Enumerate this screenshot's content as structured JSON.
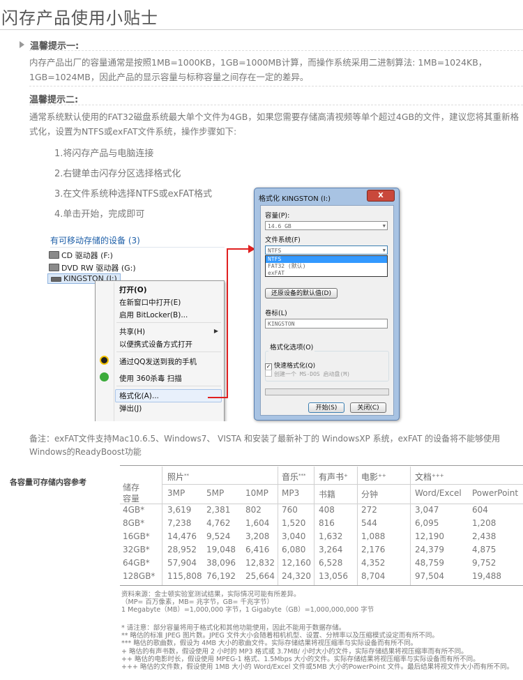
{
  "title": "闪存产品使用小贴士",
  "tip1": {
    "heading": "温馨提示一:",
    "text": "内存产品出厂的容量通常是按照1MB=1000KB，1GB=1000MB计算，而操作系统采用二进制算法: 1MB=1024KB，1GB=1024MB，因此产品的显示容量与标称容量之间存在一定的差异。"
  },
  "tip2": {
    "heading": "温馨提示二:",
    "text": "通常系统默认使用的FAT32磁盘系统最大单个文件为4GB，如果您需要存储高清视频等单个超过4GB的文件，建议您将其重新格式化，设置为NTFS或exFAT文件系统，操作步骤如下:"
  },
  "steps": [
    "1.将闪存产品与电脑连接",
    "2.右键单击闪存分区选择格式化",
    "3.在文件系统种选择NTFS或exFAT格式",
    "4.单击开始，完成即可"
  ],
  "explorer": {
    "header": "有可移动存储的设备 (3)",
    "drives": [
      "CD 驱动器 (F:)",
      "DVD RW 驱动器 (G:)",
      "KINGSTON (I:)"
    ],
    "menu": [
      "打开(O)",
      "在新窗口中打开(E)",
      "启用 BitLocker(B)...",
      "共享(H)",
      "以便携式设备方式打开",
      "通过QQ发送到我的手机",
      "使用 360杀毒 扫描",
      "格式化(A)...",
      "弹出(J)"
    ]
  },
  "dialog": {
    "title": "格式化 KINGSTON (I:)",
    "close": "X",
    "capacity_label": "容量(P):",
    "capacity_value": "14.6 GB",
    "fs_label": "文件系统(F)",
    "fs_value": "NTFS",
    "fs_options": [
      "NTFS",
      "FAT32 (默认)",
      "exFAT"
    ],
    "restore_button": "还原设备的默认值(D)",
    "volume_label": "卷标(L)",
    "volume_value": "KINGSTON",
    "options_label": "格式化选项(O)",
    "quick_format": "快速格式化(Q)",
    "msdos_disk": "创建一个 MS-DOS 启动盘(M)",
    "start_button": "开始(S)",
    "close_button": "关闭(C)"
  },
  "note": "备注：exFAT文件支持Mac10.6.5、Windows7、 VISTA 和安装了最新补丁的 WindowsXP 系统，exFAT 的设备将不能够使用Windows的ReadyBoost功能",
  "table": {
    "side_title": "各容量可存储内容参考",
    "groups": [
      {
        "label": "照片",
        "sup": "**"
      },
      {
        "label": "音乐",
        "sup": "***"
      },
      {
        "label": "有声书",
        "sup": "+"
      },
      {
        "label": "电影",
        "sup": "++"
      },
      {
        "label": "文档",
        "sup": "+++"
      }
    ],
    "capacity_header": [
      "储存",
      "容量"
    ],
    "subheaders": [
      "3MP",
      "5MP",
      "10MP",
      "MP3",
      "书籍",
      "分钟",
      "Word/Excel",
      "PowerPoint"
    ],
    "rows": [
      [
        "4GB*",
        "3,619",
        "2,381",
        "802",
        "760",
        "408",
        "272",
        "3,047",
        "604"
      ],
      [
        "8GB*",
        "7,238",
        "4,762",
        "1,604",
        "1,520",
        "816",
        "544",
        "6,095",
        "1,208"
      ],
      [
        "16GB*",
        "14,476",
        "9,524",
        "3,208",
        "3,040",
        "1,632",
        "1,088",
        "12,190",
        "2,438"
      ],
      [
        "32GB*",
        "28,952",
        "19,048",
        "6,416",
        "6,080",
        "3,264",
        "2,176",
        "24,379",
        "4,875"
      ],
      [
        "64GB*",
        "57,904",
        "38,096",
        "12,832",
        "12,160",
        "6,528",
        "4,352",
        "48,759",
        "9,752"
      ],
      [
        "128GB*",
        "115,808",
        "76,192",
        "25,664",
        "24,320",
        "13,056",
        "8,704",
        "97,504",
        "19,488"
      ]
    ]
  },
  "footnotes_a": [
    "资料来源：金士顿实验室测试结果，实际情况可能有所差异。",
    "（MP= 百万像素，MB= 兆字节，GB= 千兆字节）",
    "1 Megabyte（MB）=1,000,000 字节，1 Gigabyte（GB）=1,000,000,000 字节"
  ],
  "footnotes_b": [
    "* 请注意：部分容量将用于格式化和其他功能使用，因此不能用于数据存储。",
    "** 略估的标准 JPEG 图片数。JPEG 文件大小会随着相机机型、设置、分辨率以及压缩模式设定而有所不同。",
    "*** 略估的歌曲数，假设为 4MB 大小的歌曲文件。实际存储结果将视压缩率与实际设备而有所不同。",
    "+ 略估的有声书数，假设使用 2 小时的 MP3 格式或 3.7MB/ 小时大小的文件，实际存储结果将视压缩率而有所不同。",
    "++ 略估的电影时长，假设使用 MPEG-1 格式、1.5Mbps 大小的文件。实际存储结果将视压缩率与实际设备而有所不同。",
    "+++ 略估的文件数，假设使用 1MB 大小的 Word/Excel 文件或5MB 大小的PowerPoint 文件。最后结果将视文件大小而有所不同。"
  ]
}
